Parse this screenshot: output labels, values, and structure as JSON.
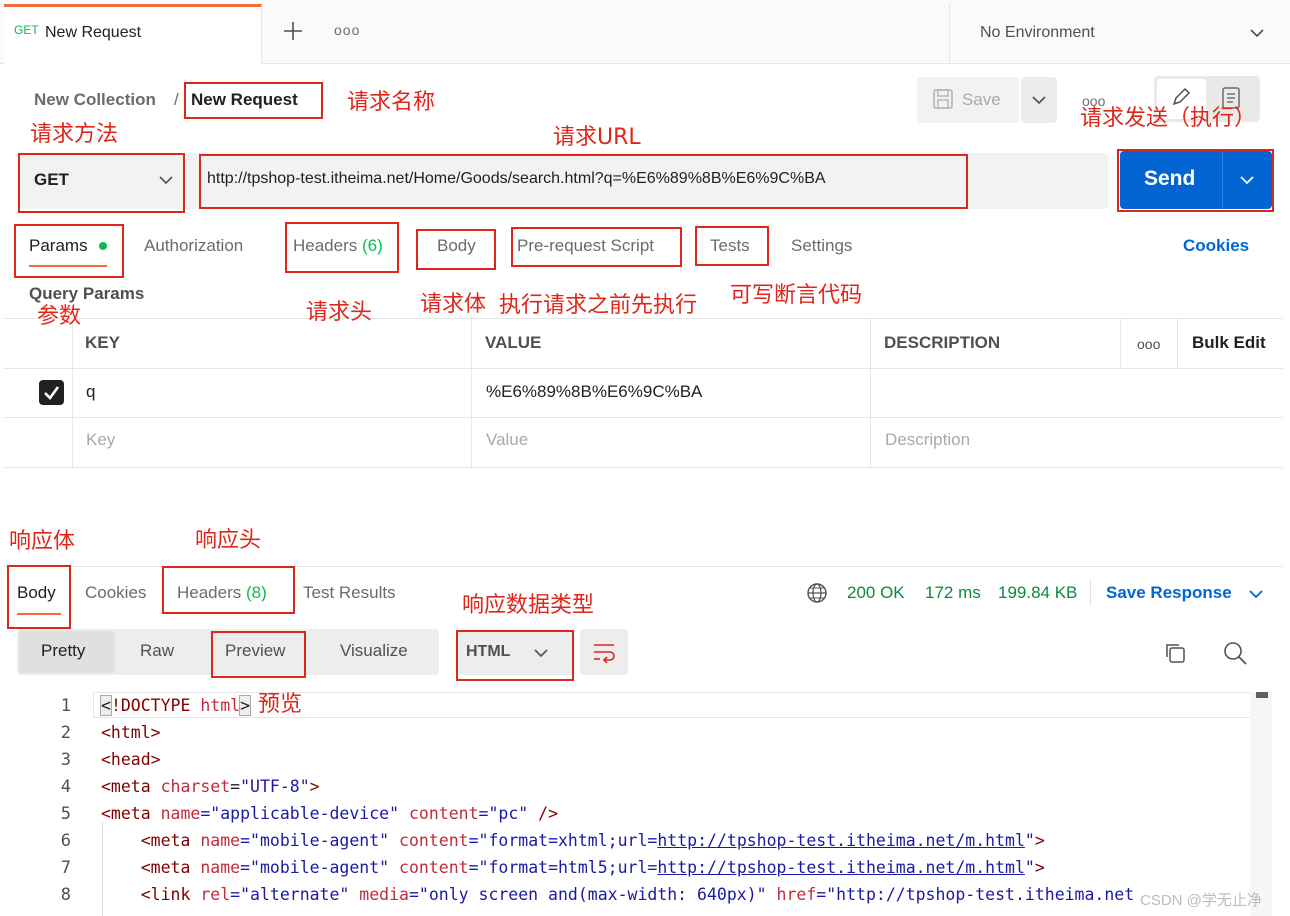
{
  "tab": {
    "method": "GET",
    "title": "New Request",
    "more": "ooo"
  },
  "environment": {
    "label": "No Environment"
  },
  "breadcrumb": {
    "collection": "New Collection",
    "separator": "/",
    "request": "New Request"
  },
  "toolbar": {
    "save_label": "Save",
    "more": "ooo"
  },
  "request": {
    "method": "GET",
    "url": "http://tpshop-test.itheima.net/Home/Goods/search.html?q=%E6%89%8B%E6%9C%BA",
    "send_label": "Send"
  },
  "request_tabs": {
    "params": "Params",
    "authorization": "Authorization",
    "headers": "Headers",
    "headers_count": "(6)",
    "body": "Body",
    "prerequest": "Pre-request Script",
    "tests": "Tests",
    "settings": "Settings",
    "cookies": "Cookies"
  },
  "query_params": {
    "title": "Query Params",
    "columns": {
      "key": "KEY",
      "value": "VALUE",
      "description": "DESCRIPTION",
      "more": "ooo",
      "bulk_edit": "Bulk Edit"
    },
    "rows": [
      {
        "key": "q",
        "value": "%E6%89%8B%E6%9C%BA",
        "checked": true
      }
    ],
    "placeholder": {
      "key": "Key",
      "value": "Value",
      "description": "Description"
    }
  },
  "response_tabs": {
    "body": "Body",
    "cookies": "Cookies",
    "headers": "Headers",
    "headers_count": "(8)",
    "test_results": "Test Results"
  },
  "response_status": {
    "status": "200 OK",
    "time": "172 ms",
    "size": "199.84 KB",
    "save_response": "Save Response"
  },
  "view_modes": {
    "pretty": "Pretty",
    "raw": "Raw",
    "preview": "Preview",
    "visualize": "Visualize",
    "format": "HTML"
  },
  "code_lines": [
    {
      "num": "1"
    },
    {
      "num": "2"
    },
    {
      "num": "3"
    },
    {
      "num": "4"
    },
    {
      "num": "5"
    },
    {
      "num": "6"
    },
    {
      "num": "7"
    },
    {
      "num": "8"
    }
  ],
  "code": {
    "l1_open": "<",
    "l1_rest": "!DOCTYPE ",
    "l1_html": "html",
    "l1_close": ">",
    "l2": "<html>",
    "l3": "<head>",
    "l4_tag": "<meta ",
    "l4_attr": "charset",
    "l4_eq": "=",
    "l4_val": "\"UTF-8\"",
    "l4_end": ">",
    "l5_tag": "<meta ",
    "l5_attr1": "name",
    "l5_val1": "=\"applicable-device\" ",
    "l5_attr2": "content",
    "l5_val2": "=\"pc\"",
    "l5_end": " />",
    "l6_tag": "    <meta ",
    "l6_attr1": "name",
    "l6_val1": "=\"mobile-agent\" ",
    "l6_attr2": "content",
    "l6_val2a": "=\"format=xhtml;url=",
    "l6_link": "http://tpshop-test.itheima.net/m.html",
    "l6_val2b": "\"",
    "l6_end": ">",
    "l7_tag": "    <meta ",
    "l7_attr1": "name",
    "l7_val1": "=\"mobile-agent\" ",
    "l7_attr2": "content",
    "l7_val2a": "=\"format=html5;url=",
    "l7_link": "http://tpshop-test.itheima.net/m.html",
    "l7_val2b": "\"",
    "l7_end": ">",
    "l8_tag": "    <link ",
    "l8_attr1": "rel",
    "l8_val1": "=\"alternate\" ",
    "l8_attr2": "media",
    "l8_val2": "=\"only screen and(max-width: 640px)\" ",
    "l8_attr3": "href",
    "l8_val3": "=\"http://tpshop-test.itheima.net"
  },
  "annotations": {
    "request_name": "请求名称",
    "request_method": "请求方法",
    "request_url": "请求URL",
    "request_send": "请求发送（执行）",
    "params": "参数",
    "headers": "请求头",
    "body": "请求体",
    "prerequest": "执行请求之前先执行",
    "tests": "可写断言代码",
    "response_body": "响应体",
    "response_headers": "响应头",
    "response_type": "响应数据类型",
    "preview": "预览"
  },
  "watermark": "CSDN @学无止净",
  "colors": {
    "accent": "#f26b3a",
    "primary": "#0265d2",
    "success": "#0cbb52",
    "annotation": "#e0261a"
  }
}
